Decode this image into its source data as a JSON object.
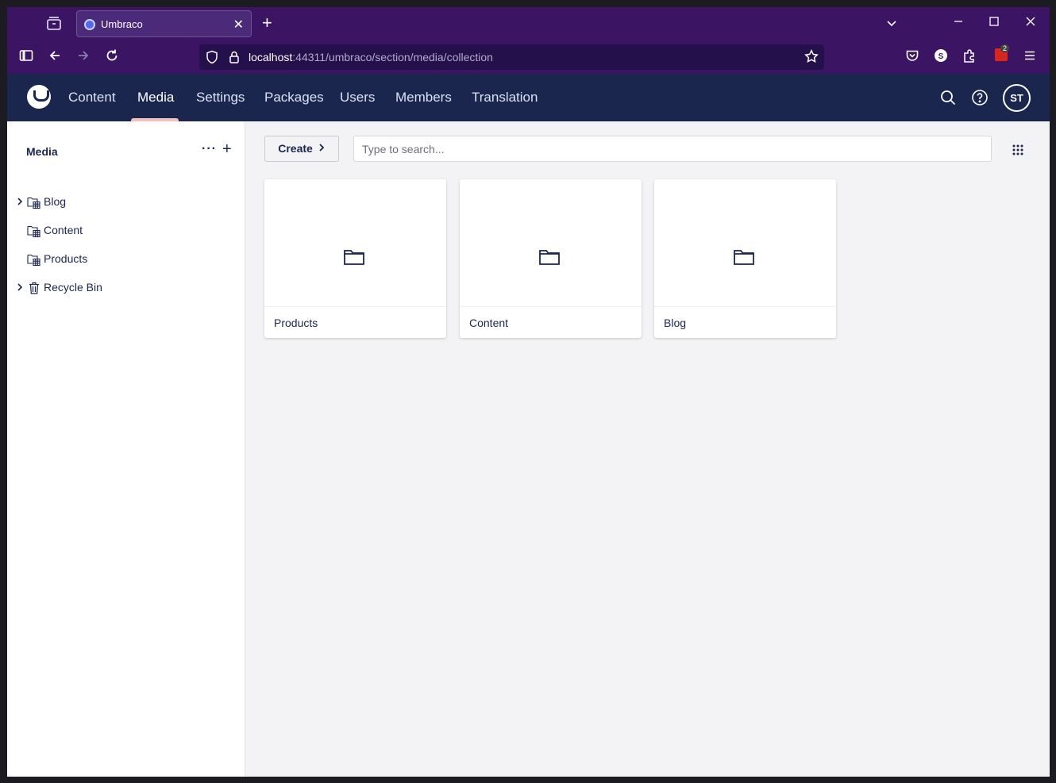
{
  "browser": {
    "tab_title": "Umbraco",
    "url_host": "localhost",
    "url_rest": ":44311/umbraco/section/media/collection",
    "extension_count": "2"
  },
  "header": {
    "sections": [
      {
        "label": "Content"
      },
      {
        "label": "Media"
      },
      {
        "label": "Settings"
      },
      {
        "label": "Packages"
      },
      {
        "label": "Users"
      },
      {
        "label": "Members"
      },
      {
        "label": "Translation"
      }
    ],
    "active_section": "Media",
    "avatar_initials": "ST"
  },
  "sidebar": {
    "title": "Media",
    "items": [
      {
        "label": "Blog",
        "expandable": true,
        "icon": "media-folder-icon"
      },
      {
        "label": "Content",
        "expandable": false,
        "icon": "media-folder-icon"
      },
      {
        "label": "Products",
        "expandable": false,
        "icon": "media-folder-icon"
      },
      {
        "label": "Recycle Bin",
        "expandable": true,
        "icon": "trash-icon"
      }
    ]
  },
  "toolbar": {
    "create_label": "Create",
    "search_placeholder": "Type to search..."
  },
  "cards": [
    {
      "name": "Products",
      "icon": "folder-icon"
    },
    {
      "name": "Content",
      "icon": "folder-icon"
    },
    {
      "name": "Blog",
      "icon": "folder-icon"
    }
  ],
  "colors": {
    "browser_chrome": "#3b1463",
    "header": "#1b264f",
    "active_indicator": "#f5c1bc",
    "text": "#1b264f"
  }
}
